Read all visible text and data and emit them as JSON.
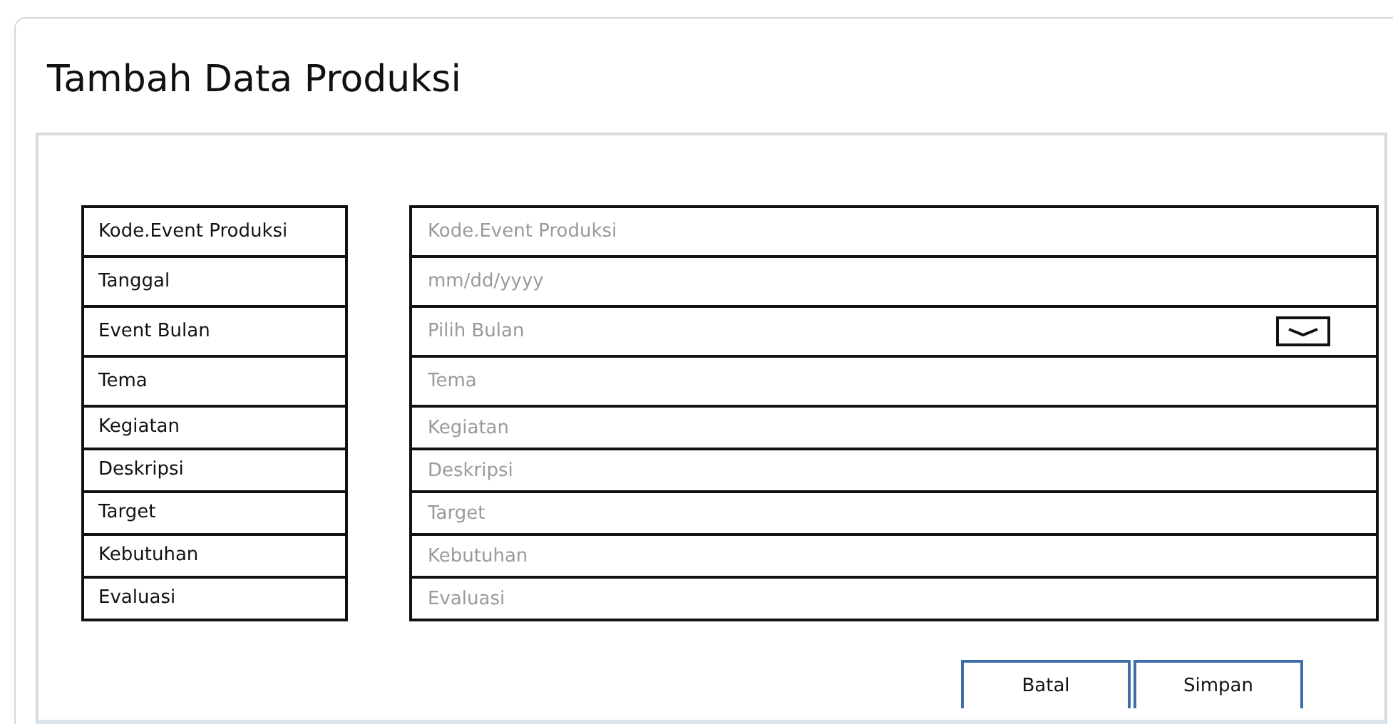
{
  "title": "Tambah Data Produksi",
  "fields": [
    {
      "label": "Kode.Event Produksi",
      "placeholder": "Kode.Event Produksi",
      "kind": "text"
    },
    {
      "label": "Tanggal",
      "placeholder": "mm/dd/yyyy",
      "kind": "text"
    },
    {
      "label": "Event Bulan",
      "placeholder": "Pilih Bulan",
      "kind": "select"
    },
    {
      "label": "Tema",
      "placeholder": "Tema",
      "kind": "text"
    },
    {
      "label": "Kegiatan",
      "placeholder": "Kegiatan",
      "kind": "text"
    },
    {
      "label": "Deskripsi",
      "placeholder": "Deskripsi",
      "kind": "text"
    },
    {
      "label": "Target",
      "placeholder": "Target",
      "kind": "text"
    },
    {
      "label": "Kebutuhan",
      "placeholder": "Kebutuhan",
      "kind": "text"
    },
    {
      "label": "Evaluasi",
      "placeholder": "Evaluasi",
      "kind": "text"
    }
  ],
  "buttons": [
    "Batal",
    "Simpan"
  ]
}
